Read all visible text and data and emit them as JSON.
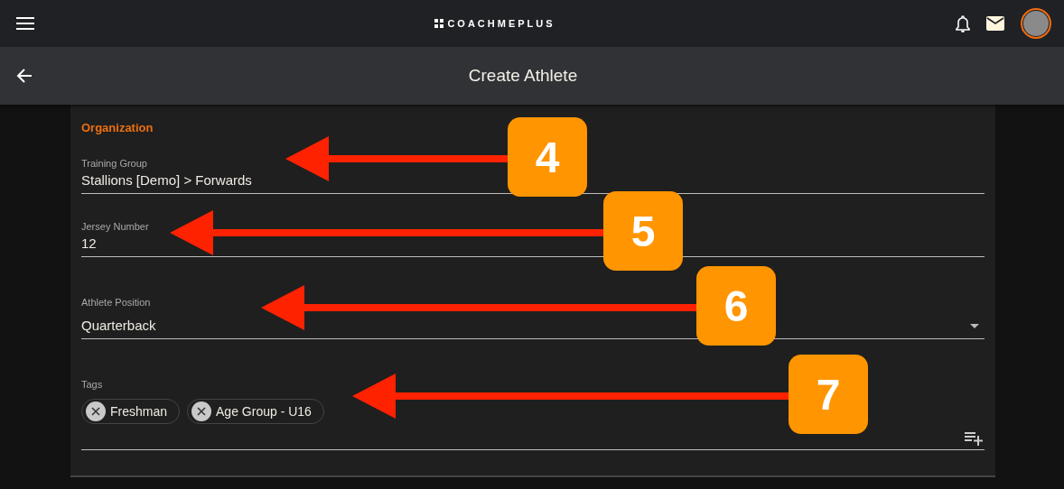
{
  "top_bar": {
    "logo_text": "COACHMEPLUS"
  },
  "header": {
    "title": "Create Athlete"
  },
  "form": {
    "section_title": "Organization",
    "fields": [
      {
        "kind": "text",
        "label": "Training Group",
        "value": "Stallions [Demo] > Forwards"
      },
      {
        "kind": "text",
        "label": "Jersey Number",
        "value": "12"
      },
      {
        "kind": "select",
        "label": "Athlete Position",
        "value": "Quarterback"
      },
      {
        "kind": "tags",
        "label": "Tags",
        "tags": [
          "Freshman",
          "Age Group - U16"
        ]
      }
    ]
  },
  "callouts": [
    {
      "number": "4"
    },
    {
      "number": "5"
    },
    {
      "number": "6"
    },
    {
      "number": "7"
    }
  ]
}
